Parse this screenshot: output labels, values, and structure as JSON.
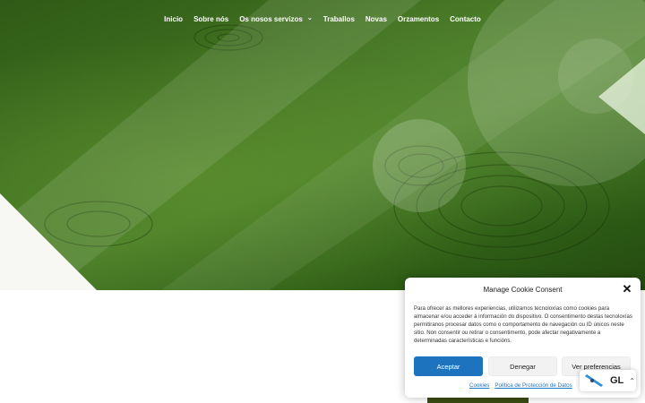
{
  "nav": {
    "items": [
      {
        "label": "Inicio"
      },
      {
        "label": "Sobre nós"
      },
      {
        "label": "Os nosos servizos",
        "has_dropdown": true
      },
      {
        "label": "Traballos"
      },
      {
        "label": "Novas"
      },
      {
        "label": "Orzamentos"
      },
      {
        "label": "Contacto"
      }
    ],
    "chevron_icon": "chevron-down-icon"
  },
  "cookie": {
    "title": "Manage Cookie Consent",
    "close_icon": "close-icon",
    "text": "Para ofrecer as mellores experiencias, utilizamos tecnoloxías como cookies para almacenar e/ou acceder á información do dispositivo. O consentimento destas tecnoloxías permitiranos procesar datos como o comportamento de navegación ou ID únicos neste sitio. Non consentir ou retirar o consentimento, pode afectar negativamente a determinadas características e funcións.",
    "accept_label": "Aceptar",
    "deny_label": "Denegar",
    "prefs_label": "Ver preferencias",
    "links": [
      "Cookies",
      "Política de Protección de Datos"
    ],
    "accept_color": "#1e73be"
  },
  "language": {
    "code": "GL",
    "flag_icon": "galician-flag-icon",
    "chevron_icon": "chevron-up-icon"
  },
  "colors": {
    "hero_green": "#3f6f1f",
    "accent_blue": "#1e73be"
  }
}
